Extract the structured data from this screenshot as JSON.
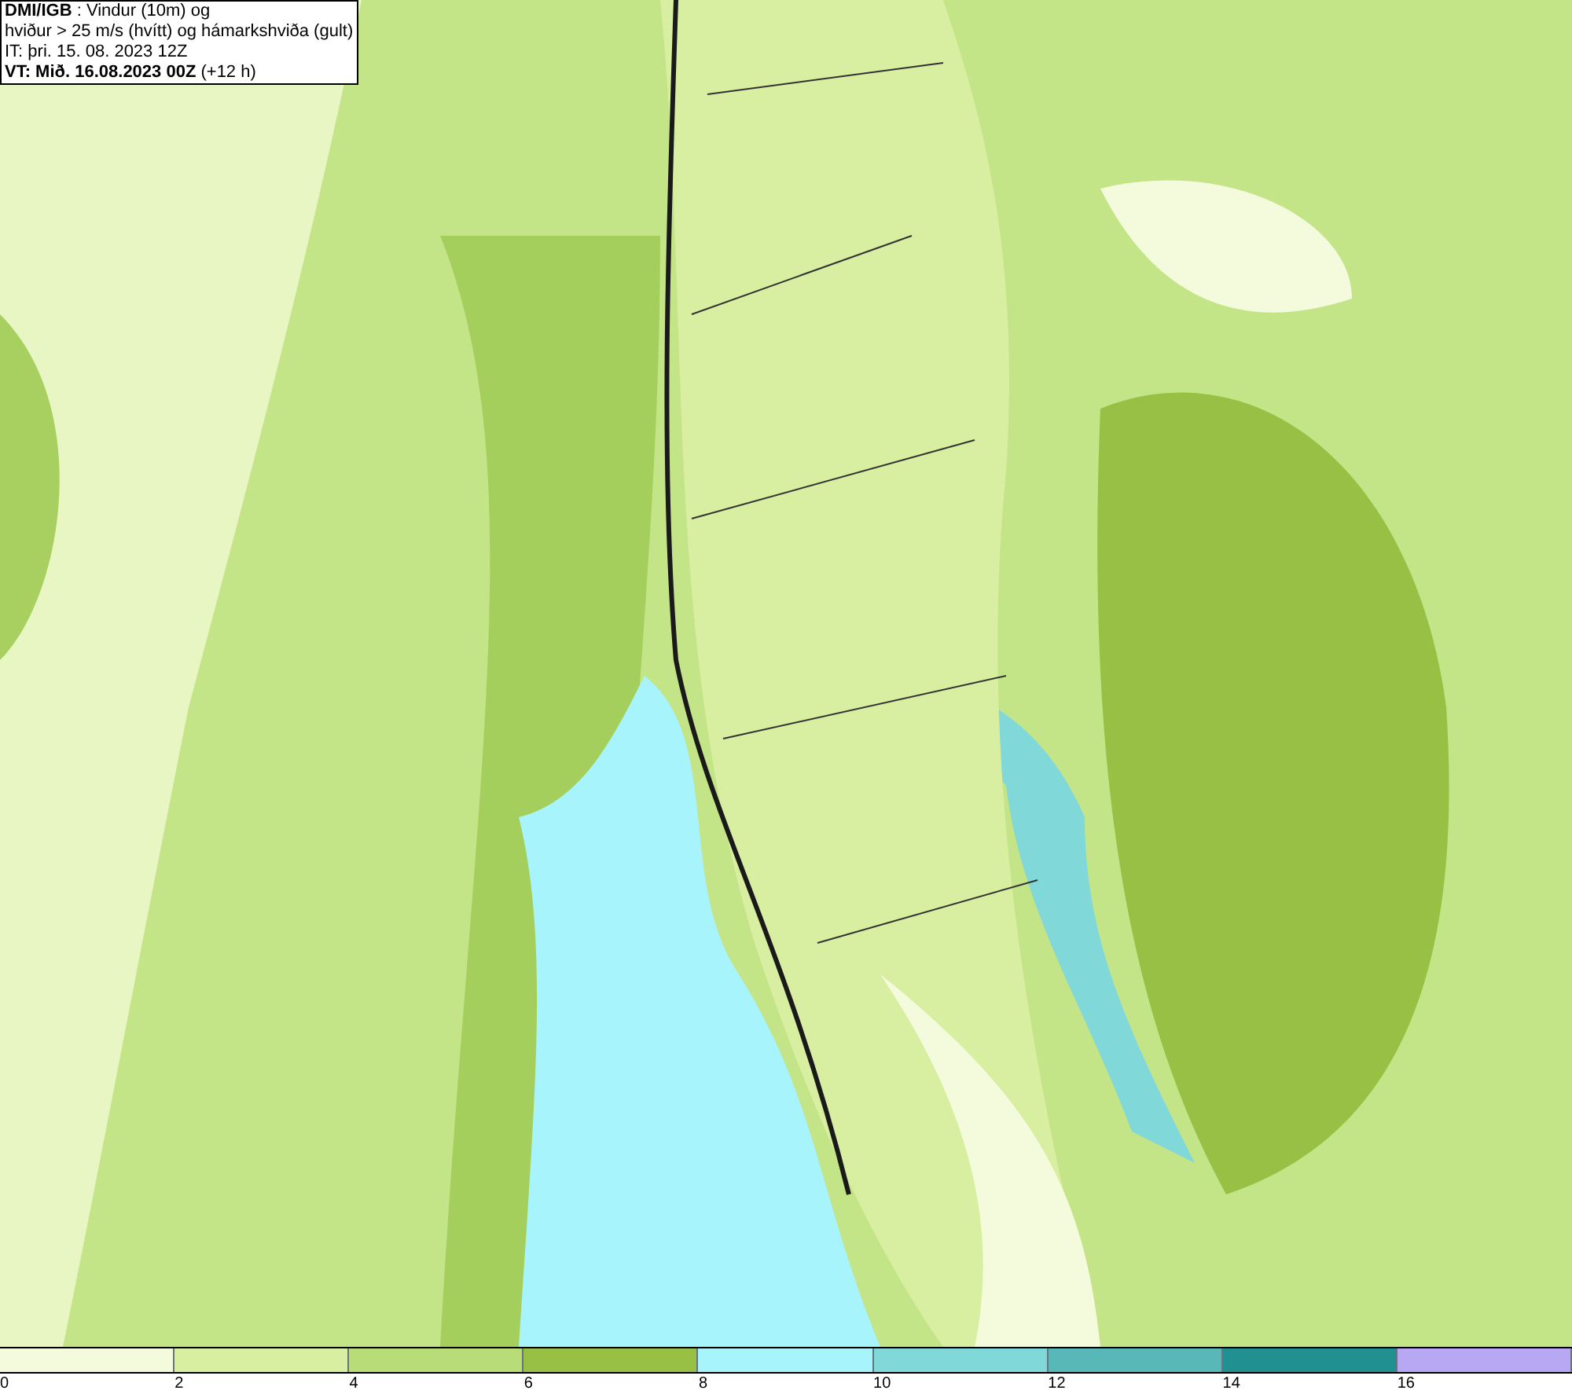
{
  "header": {
    "lines": [
      "**DMI/IGB** : Vindur (10m) og",
      "hviður > 25 m/s (hvítt) og hámarkshviða (gult)",
      "IT: þri. 15. 08. 2023 12Z",
      "**VT: Mið. 16.08.2023 00Z** (+12 h)"
    ]
  },
  "legend": {
    "bins": [
      {
        "color": "#f4fbdc"
      },
      {
        "color": "#d8eea0"
      },
      {
        "color": "#b8dc78"
      },
      {
        "color": "#98c044"
      },
      {
        "color": "#a8f4fc"
      },
      {
        "color": "#80d8d8"
      },
      {
        "color": "#58b8b8"
      },
      {
        "color": "#209090"
      },
      {
        "color": "#b8a8f4"
      }
    ],
    "ticks": [
      "0",
      "2",
      "4",
      "6",
      "8",
      "10",
      "12",
      "14",
      "16"
    ]
  }
}
